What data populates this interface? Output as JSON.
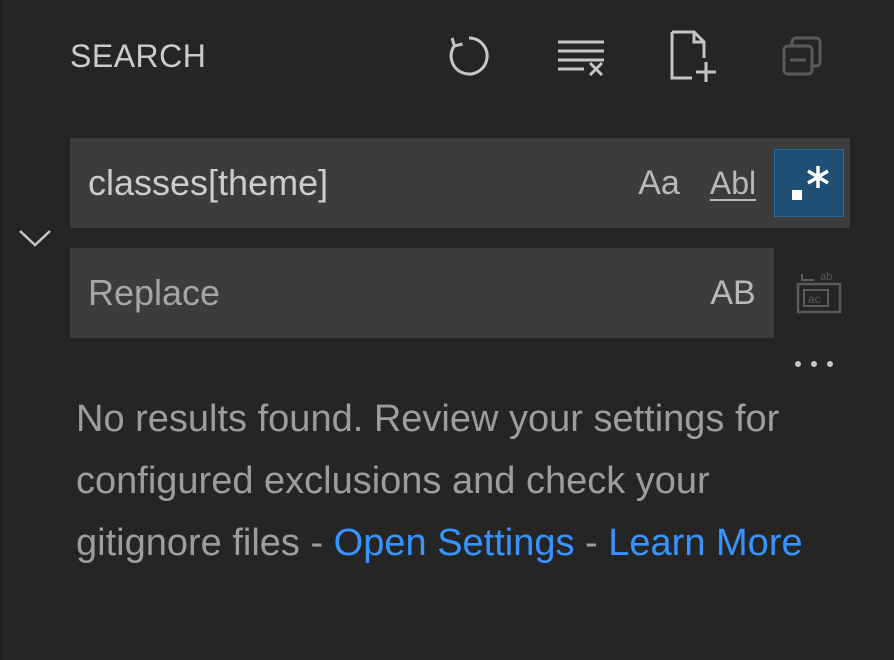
{
  "header": {
    "title": "SEARCH",
    "actions": [
      {
        "name": "refresh",
        "icon": "refresh-icon"
      },
      {
        "name": "clear-results",
        "icon": "clear-all-icon"
      },
      {
        "name": "new-search-editor",
        "icon": "new-file-icon"
      },
      {
        "name": "collapse-all",
        "icon": "collapse-all-icon",
        "disabled": true
      }
    ]
  },
  "search": {
    "value": "classes[theme]",
    "match_case_label": "Aa",
    "whole_word_label": "Abl",
    "regex_label": ".*",
    "regex_enabled": true
  },
  "replace": {
    "value": "",
    "placeholder": "Replace",
    "preserve_case_label": "AB"
  },
  "results": {
    "message": "No results found. Review your settings for configured exclusions and check your gitignore files - ",
    "open_settings_link": "Open Settings",
    "separator": " - ",
    "learn_more_link": "Learn More"
  },
  "colors": {
    "background": "#252526",
    "input_background": "#3c3c3c",
    "active_toggle": "#1f4f74",
    "link": "#3794ff",
    "text_muted": "#9d9d9d"
  }
}
